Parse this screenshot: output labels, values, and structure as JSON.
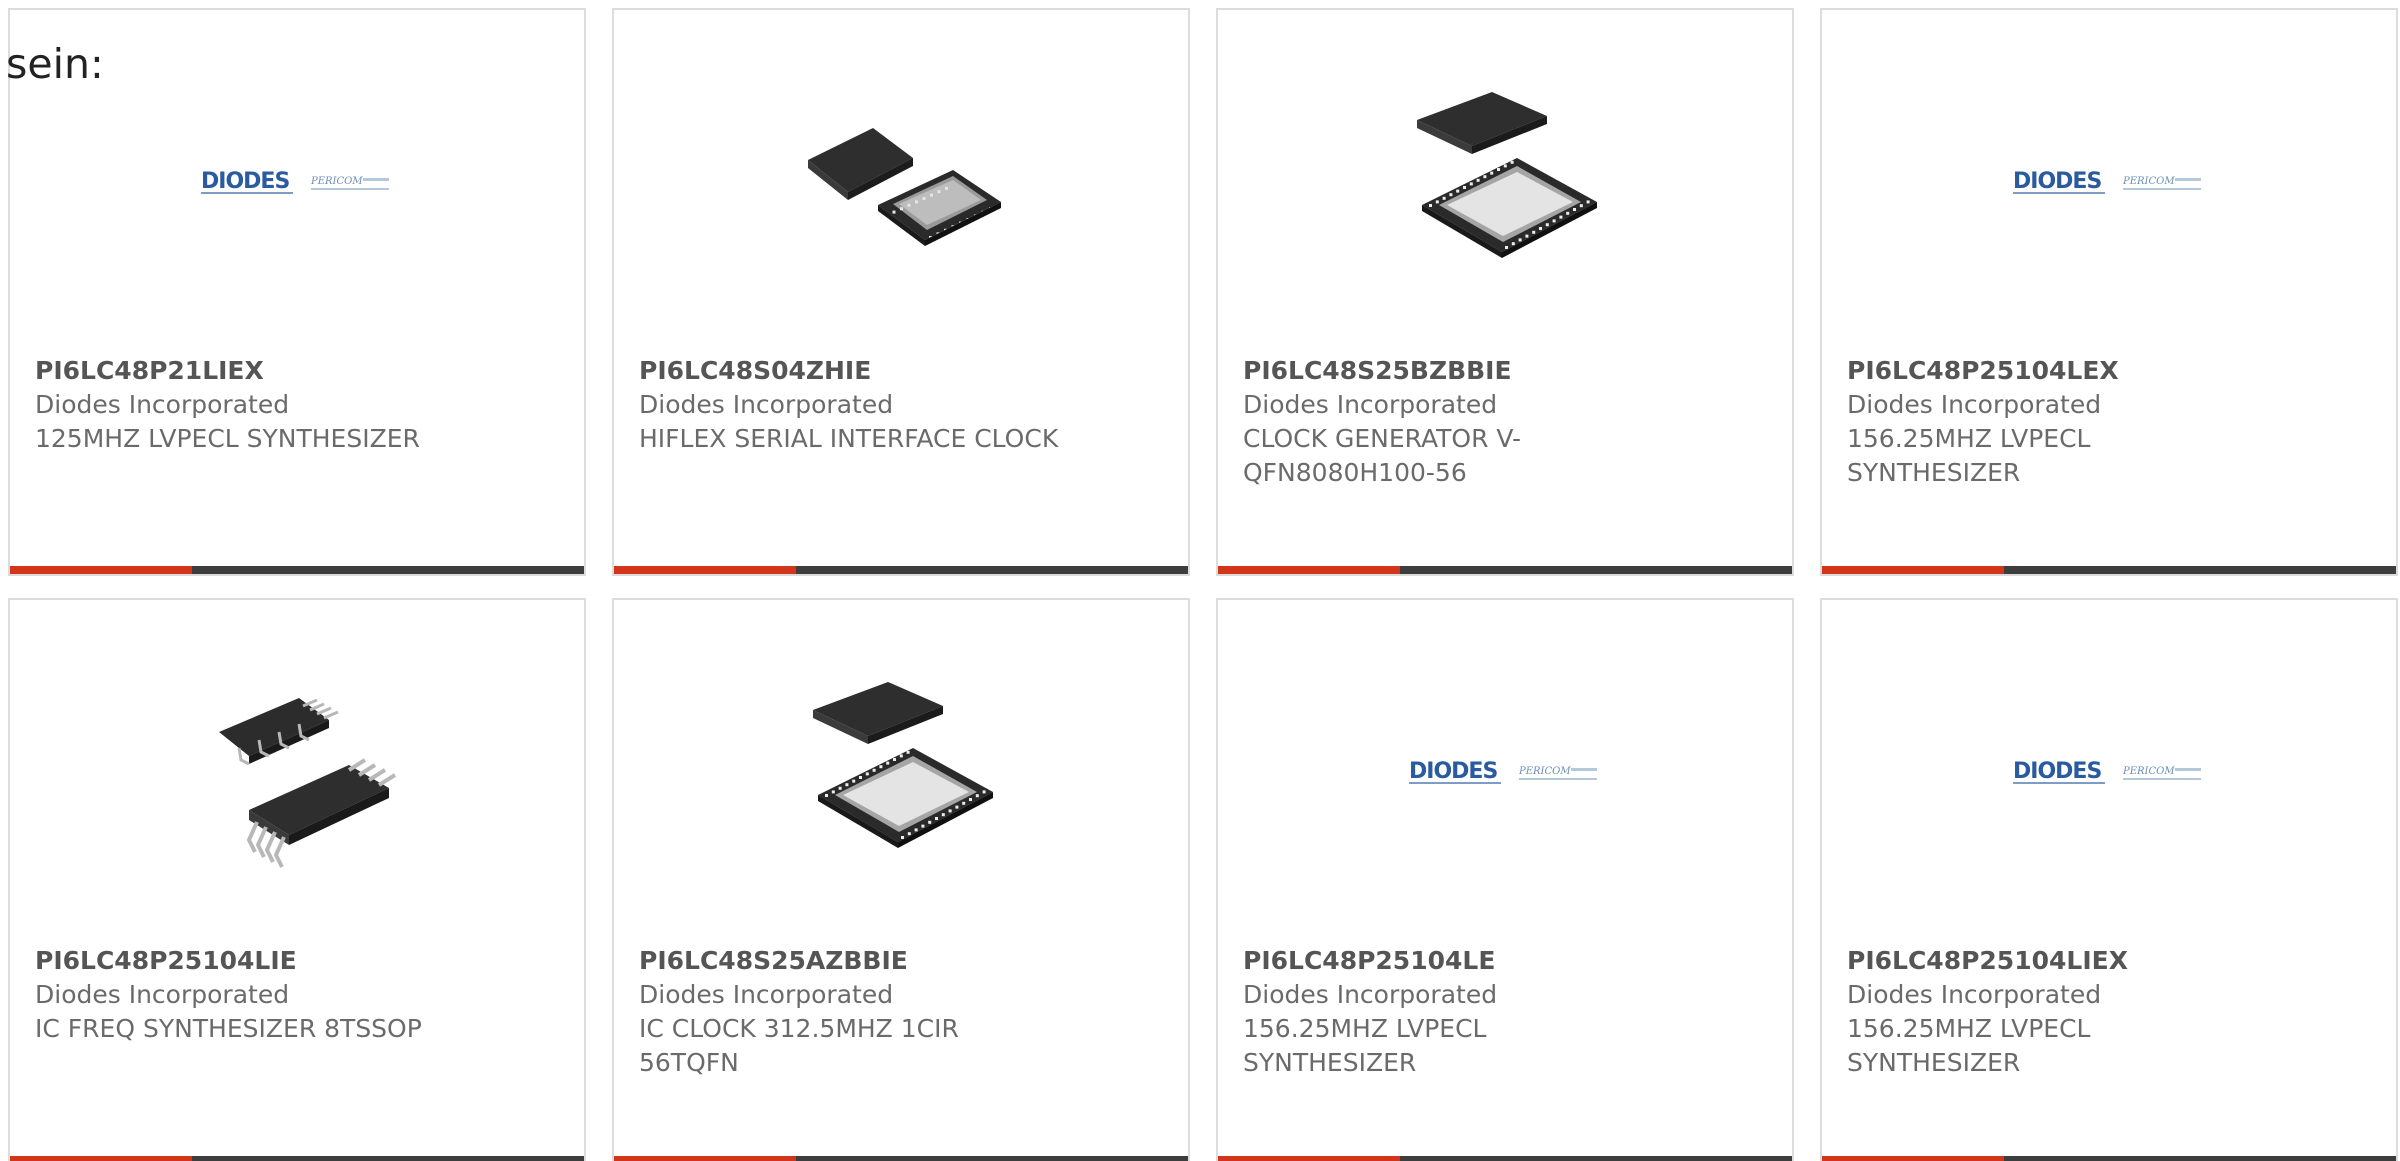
{
  "intro": {
    "text": "sein:"
  },
  "colors": {
    "accent_bar": "#d3351b",
    "bar": "#3d3d3d",
    "border": "#dcdcdc",
    "text": "#6a6a6a"
  },
  "products": [
    {
      "part_number": "PI6LC48P21LIEX",
      "manufacturer": "Diodes Incorporated",
      "description": "125MHZ LVPECL SYNTHESIZER",
      "image": "diodes-pericom-logo"
    },
    {
      "part_number": "PI6LC48S04ZHIE",
      "manufacturer": "Diodes Incorporated",
      "description": "HIFLEX SERIAL INTERFACE CLOCK",
      "image": "qfn-chip-small"
    },
    {
      "part_number": "PI6LC48S25BZBBIE",
      "manufacturer": "Diodes Incorporated",
      "description": "CLOCK GENERATOR V-QFN8080H100-56",
      "image": "qfn-chip-large"
    },
    {
      "part_number": "PI6LC48P25104LEX",
      "manufacturer": "Diodes Incorporated",
      "description": "156.25MHZ LVPECL SYNTHESIZER",
      "image": "diodes-pericom-logo"
    },
    {
      "part_number": "PI6LC48P25104LIE",
      "manufacturer": "Diodes Incorporated",
      "description": "IC FREQ SYNTHESIZER 8TSSOP",
      "image": "tssop-chip"
    },
    {
      "part_number": "PI6LC48S25AZBBIE",
      "manufacturer": "Diodes Incorporated",
      "description": "IC CLOCK 312.5MHZ 1CIR 56TQFN",
      "image": "qfn-chip-large"
    },
    {
      "part_number": "PI6LC48P25104LE",
      "manufacturer": "Diodes Incorporated",
      "description": "156.25MHZ LVPECL SYNTHESIZER",
      "image": "diodes-pericom-logo"
    },
    {
      "part_number": "PI6LC48P25104LIEX",
      "manufacturer": "Diodes Incorporated",
      "description": "156.25MHZ LVPECL SYNTHESIZER",
      "image": "diodes-pericom-logo"
    }
  ],
  "logo": {
    "brand": "DIODES",
    "sub_brand": "PERICOM",
    "brand_color": "#2a5aa0",
    "sub_color": "#6a8fb8"
  }
}
